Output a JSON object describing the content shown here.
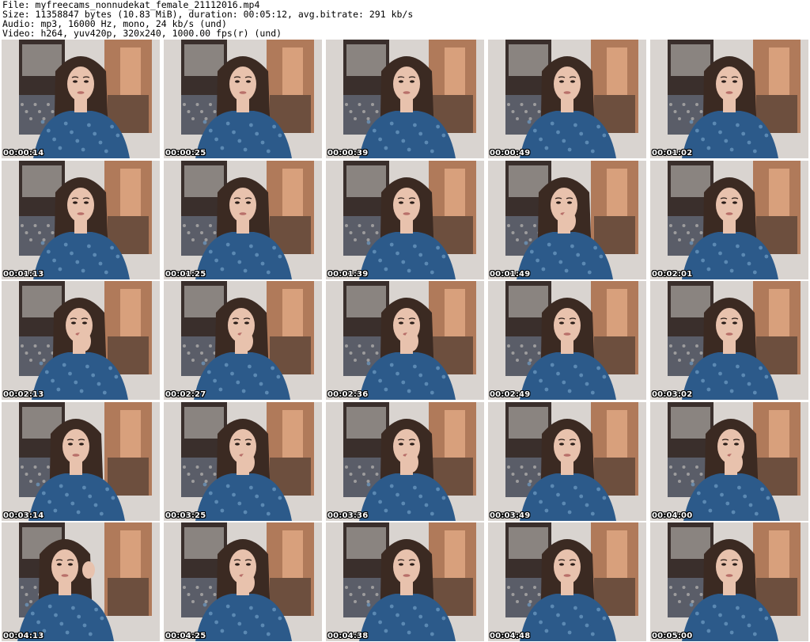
{
  "header": {
    "file_line": "File: myfreecams_nonnudekat_female_21112016.mp4",
    "size_line": "Size: 11358847 bytes (10.83 MiB), duration: 00:05:12, avg.bitrate: 291 kb/s",
    "audio_line": "Audio: mp3, 16000 Hz, mono, 24 kb/s (und)",
    "video_line": "Video: h264, yuv420p, 320x240, 1000.00 fps(r) (und)"
  },
  "thumbnails": [
    {
      "timestamp": "00:00:14"
    },
    {
      "timestamp": "00:00:25"
    },
    {
      "timestamp": "00:00:39"
    },
    {
      "timestamp": "00:00:49"
    },
    {
      "timestamp": "00:01:02"
    },
    {
      "timestamp": "00:01:13"
    },
    {
      "timestamp": "00:01:25"
    },
    {
      "timestamp": "00:01:39"
    },
    {
      "timestamp": "00:01:49"
    },
    {
      "timestamp": "00:02:01"
    },
    {
      "timestamp": "00:02:13"
    },
    {
      "timestamp": "00:02:27"
    },
    {
      "timestamp": "00:02:36"
    },
    {
      "timestamp": "00:02:49"
    },
    {
      "timestamp": "00:03:02"
    },
    {
      "timestamp": "00:03:14"
    },
    {
      "timestamp": "00:03:25"
    },
    {
      "timestamp": "00:03:36"
    },
    {
      "timestamp": "00:03:49"
    },
    {
      "timestamp": "00:04:00"
    },
    {
      "timestamp": "00:04:13"
    },
    {
      "timestamp": "00:04:25"
    },
    {
      "timestamp": "00:04:38"
    },
    {
      "timestamp": "00:04:48"
    },
    {
      "timestamp": "00:05:00"
    }
  ],
  "colors": {
    "wall": "#d9d4d0",
    "poster_dark": "#3a2f2c",
    "poster_warm": "#b07a5a",
    "hair": "#3b2a22",
    "skin": "#e8c2ad",
    "dress": "#2c5a8a",
    "dress_pattern": "#6f9cc4"
  }
}
